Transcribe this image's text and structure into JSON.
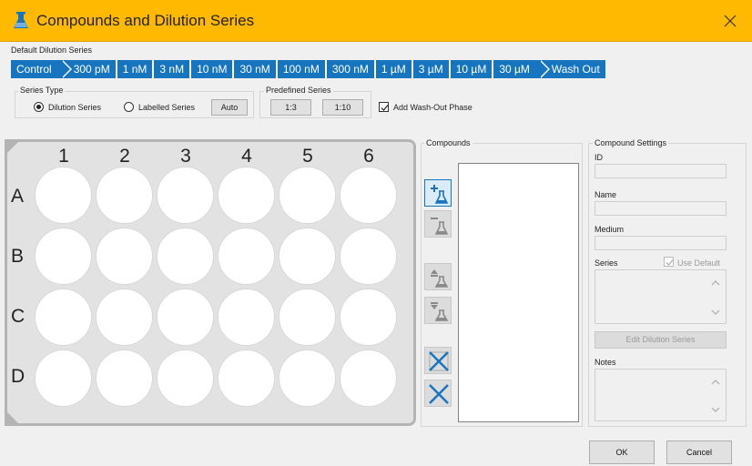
{
  "window": {
    "title": "Compounds and Dilution Series",
    "accent_color": "#ffb900",
    "title_icon": "flask-icon",
    "close_icon": "close-icon"
  },
  "default_series": {
    "label": "Default Dilution Series",
    "steps": [
      "Control",
      "300 pM",
      "1 nM",
      "3 nM",
      "10 nM",
      "30 nM",
      "100 nM",
      "300 nM",
      "1 µM",
      "3 µM",
      "10 µM",
      "30 µM",
      "Wash Out"
    ],
    "step_color": "#1775c0"
  },
  "series_type": {
    "label": "Series Type",
    "options": [
      "Dilution Series",
      "Labelled Series"
    ],
    "selected": "Dilution Series",
    "auto_label": "Auto"
  },
  "predefined": {
    "label": "Predefined Series",
    "buttons": [
      "1:3",
      "1:10"
    ]
  },
  "washout": {
    "label": "Add Wash-Out Phase",
    "checked": true
  },
  "plate": {
    "columns": [
      "1",
      "2",
      "3",
      "4",
      "5",
      "6"
    ],
    "rows": [
      "A",
      "B",
      "C",
      "D"
    ]
  },
  "compounds": {
    "label": "Compounds",
    "toolbar_icons": [
      "add-compound-icon",
      "remove-compound-icon",
      "move-up-icon",
      "move-down-icon",
      "clear-selected-icon",
      "clear-all-icon"
    ]
  },
  "settings": {
    "label": "Compound Settings",
    "id_label": "ID",
    "name_label": "Name",
    "medium_label": "Medium",
    "series_label": "Series",
    "use_default_label": "Use Default",
    "use_default_checked": true,
    "edit_series_label": "Edit Dilution Series",
    "notes_label": "Notes"
  },
  "footer": {
    "ok_label": "OK",
    "cancel_label": "Cancel"
  }
}
